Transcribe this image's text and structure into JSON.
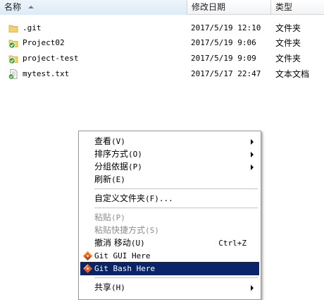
{
  "header": {
    "name_label": "名称",
    "date_label": "修改日期",
    "type_label": "类型"
  },
  "files": [
    {
      "icon": "folder-icon",
      "name": ".git",
      "date": "2017/5/19 12:10",
      "type": "文件夹"
    },
    {
      "icon": "git-folder-icon",
      "name": "Project02",
      "date": "2017/5/19 9:06",
      "type": "文件夹"
    },
    {
      "icon": "git-folder-icon",
      "name": "project-test",
      "date": "2017/5/19 9:09",
      "type": "文件夹"
    },
    {
      "icon": "git-text-file-icon",
      "name": "mytest.txt",
      "date": "2017/5/17 22:47",
      "type": "文本文档"
    }
  ],
  "menu": {
    "view": {
      "label": "查看",
      "accel": "(V)"
    },
    "sort": {
      "label": "排序方式",
      "accel": "(O)"
    },
    "group": {
      "label": "分组依据",
      "accel": "(P)"
    },
    "refresh": {
      "label": "刷新",
      "accel": "(E)"
    },
    "customize": {
      "label": "自定义文件夹",
      "accel": "(F)..."
    },
    "paste": {
      "label": "粘贴",
      "accel": "(P)"
    },
    "paste_shortcut": {
      "label": "粘贴快捷方式",
      "accel": "(S)"
    },
    "undo": {
      "label": "撤消 移动",
      "accel": "(U)",
      "shortcut": "Ctrl+Z"
    },
    "git_gui": {
      "label": "Git GUI Here"
    },
    "git_bash": {
      "label": "Git Bash Here"
    },
    "share": {
      "label": "共享",
      "accel": "(H)"
    }
  },
  "colors": {
    "menu_highlight": "#0a246a",
    "git_green": "#3a9a2e",
    "folder_yellow": "#f3d36b"
  }
}
